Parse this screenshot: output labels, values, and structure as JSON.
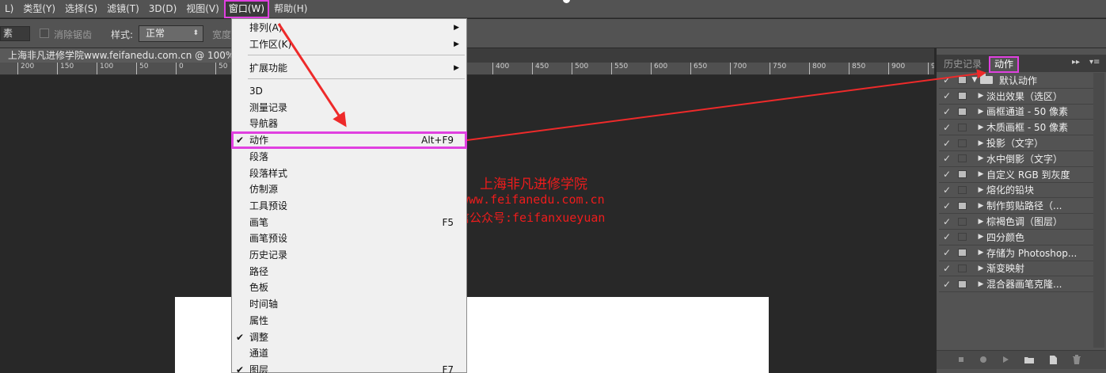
{
  "menubar": {
    "items": [
      {
        "label": "L)"
      },
      {
        "label": "类型(Y)"
      },
      {
        "label": "选择(S)"
      },
      {
        "label": "滤镜(T)"
      },
      {
        "label": "3D(D)"
      },
      {
        "label": "视图(V)"
      },
      {
        "label": "窗口(W)"
      },
      {
        "label": "帮助(H)"
      }
    ]
  },
  "options": {
    "feather_value": "素",
    "antialias_label": "消除锯齿",
    "style_label": "样式:",
    "style_value": "正常",
    "width_label": "宽度"
  },
  "document": {
    "tab_title": "上海非凡进修学院www.feifanedu.com.cn @ 100%(RGB/8)"
  },
  "ruler": {
    "ticks": [
      "200",
      "150",
      "100",
      "50",
      "0",
      "50",
      "400",
      "450",
      "500",
      "550",
      "600",
      "650",
      "700",
      "750",
      "800",
      "850",
      "900",
      "950",
      "1000",
      "1050",
      "1100"
    ]
  },
  "window_menu": {
    "items": [
      {
        "label": "排列(A)",
        "submenu": true
      },
      {
        "label": "工作区(K)",
        "submenu": true
      },
      {
        "label": "扩展功能",
        "submenu": true
      },
      {
        "label": "3D"
      },
      {
        "label": "测量记录"
      },
      {
        "label": "导航器"
      },
      {
        "label": "动作",
        "shortcut": "Alt+F9",
        "checked": true
      },
      {
        "label": "段落"
      },
      {
        "label": "段落样式"
      },
      {
        "label": "仿制源"
      },
      {
        "label": "工具预设"
      },
      {
        "label": "画笔",
        "shortcut": "F5"
      },
      {
        "label": "画笔预设"
      },
      {
        "label": "历史记录"
      },
      {
        "label": "路径"
      },
      {
        "label": "色板"
      },
      {
        "label": "时间轴"
      },
      {
        "label": "属性"
      },
      {
        "label": "调整",
        "checked": true
      },
      {
        "label": "通道"
      },
      {
        "label": "图层",
        "shortcut": "F7",
        "checked": true
      }
    ]
  },
  "watermark": {
    "line1": "上海非凡进修学院",
    "line2": "www.feifanedu.com.cn",
    "line3": "微信公众号:feifanxueyuan"
  },
  "panel": {
    "tab_history": "历史记录",
    "tab_actions": "动作",
    "check_glyph": "✓",
    "actions": [
      {
        "name": "默认动作",
        "dialog": true
      },
      {
        "name": "淡出效果（选区）",
        "dialog": true
      },
      {
        "name": "画框通道 - 50 像素",
        "dialog": true
      },
      {
        "name": "木质画框 - 50 像素",
        "dialog": false
      },
      {
        "name": "投影（文字）",
        "dialog": false
      },
      {
        "name": "水中倒影（文字）",
        "dialog": false
      },
      {
        "name": "自定义 RGB 到灰度",
        "dialog": true
      },
      {
        "name": "熔化的铅块",
        "dialog": false
      },
      {
        "name": "制作剪贴路径（...",
        "dialog": true
      },
      {
        "name": "棕褐色调（图层）",
        "dialog": false
      },
      {
        "name": "四分颜色",
        "dialog": false
      },
      {
        "name": "存储为 Photoshop...",
        "dialog": true
      },
      {
        "name": "渐变映射",
        "dialog": false
      },
      {
        "name": "混合器画笔克隆...",
        "dialog": true
      }
    ]
  },
  "colors": {
    "highlight": "#e040e0",
    "arrow": "#ee2a2a",
    "watermark": "#ee1c1c"
  }
}
